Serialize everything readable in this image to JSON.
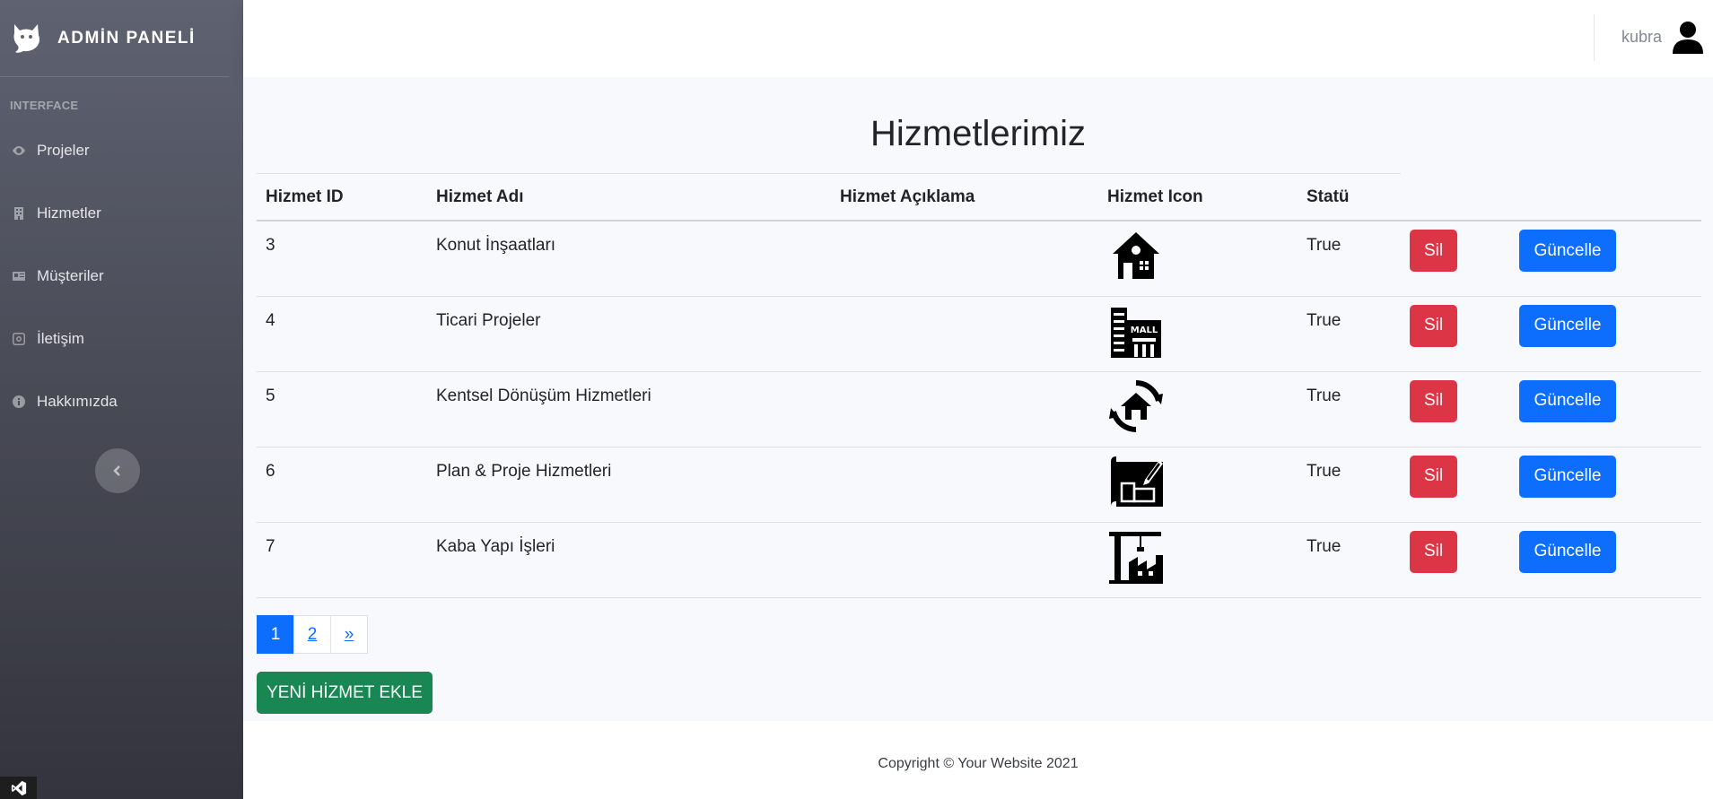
{
  "sidebar": {
    "brand": "ADMİN PANELİ",
    "heading": "INTERFACE",
    "items": [
      {
        "label": "Projeler",
        "icon": "eye-icon"
      },
      {
        "label": "Hizmetler",
        "icon": "building-icon"
      },
      {
        "label": "Müşteriler",
        "icon": "id-card-icon"
      },
      {
        "label": "İletişim",
        "icon": "instagram-icon"
      },
      {
        "label": "Hakkımızda",
        "icon": "info-icon"
      }
    ]
  },
  "topbar": {
    "user": "kubra"
  },
  "page": {
    "title": "Hizmetlerimiz"
  },
  "table": {
    "headers": [
      "Hizmet ID",
      "Hizmet Adı",
      "Hizmet Açıklama",
      "Hizmet Icon",
      "Statü"
    ],
    "rows": [
      {
        "id": "3",
        "name": "Konut İnşaatları",
        "description": "",
        "icon": "house-icon",
        "status": "True",
        "delete": "Sil",
        "update": "Güncelle"
      },
      {
        "id": "4",
        "name": "Ticari Projeler",
        "description": "",
        "icon": "mall-icon",
        "status": "True",
        "delete": "Sil",
        "update": "Güncelle"
      },
      {
        "id": "5",
        "name": "Kentsel Dönüşüm Hizmetleri",
        "description": "",
        "icon": "urban-renewal-icon",
        "status": "True",
        "delete": "Sil",
        "update": "Güncelle"
      },
      {
        "id": "6",
        "name": "Plan & Proje Hizmetleri",
        "description": "",
        "icon": "blueprint-icon",
        "status": "True",
        "delete": "Sil",
        "update": "Güncelle"
      },
      {
        "id": "7",
        "name": "Kaba Yapı İşleri",
        "description": "",
        "icon": "crane-icon",
        "status": "True",
        "delete": "Sil",
        "update": "Güncelle"
      }
    ]
  },
  "pagination": {
    "pages": [
      "1",
      "2",
      "»"
    ],
    "active": "1"
  },
  "actions": {
    "add": "YENİ HİZMET EKLE"
  },
  "footer": {
    "copyright": "Copyright © Your Website 2021"
  },
  "colors": {
    "danger": "#dc3545",
    "primary": "#0d6efd",
    "success": "#198754"
  }
}
